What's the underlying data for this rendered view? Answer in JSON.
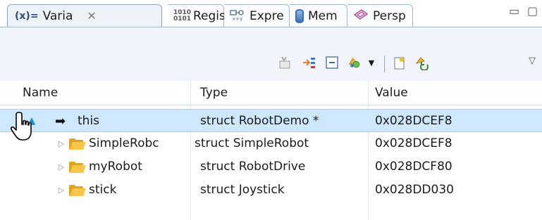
{
  "tabs": [
    {
      "label": "Varia",
      "icon": "variables-icon",
      "active": true,
      "close": "✕"
    },
    {
      "label": "Regis",
      "icon": "registers-icon"
    },
    {
      "label": "Expre",
      "icon": "expressions-icon"
    },
    {
      "label": "Mem",
      "icon": "memory-icon"
    },
    {
      "label": "Persp",
      "icon": "perspective-icon"
    }
  ],
  "icon_text": {
    "variables": "(x)=",
    "registers": "1010 0101"
  },
  "window_controls": {
    "minimize": "▭",
    "maximize": "▢"
  },
  "toolbar_icons": [
    "collapse-variables-icon",
    "show-type-names-icon",
    "collapse-all-icon",
    "add-global-variables-icon",
    "view-menu-dropdown-icon",
    "new-watch-expression-icon",
    "remove-global-variables-icon",
    "view-menu-icon"
  ],
  "table": {
    "columns": [
      "Name",
      "Type",
      "Value"
    ],
    "rows": [
      {
        "name": "this",
        "type": "struct RobotDemo *",
        "value": "0x028DCEF8",
        "expander": "expanded",
        "icon": "pointer-arrow-icon",
        "selected": true
      },
      {
        "name": "SimpleRobc",
        "type": "struct SimpleRobot",
        "value": "0x028DCEF8",
        "expander": "collapsed",
        "icon": "folder-icon"
      },
      {
        "name": "myRobot",
        "type": "struct RobotDrive",
        "value": "0x028DCF80",
        "expander": "collapsed",
        "icon": "folder-icon"
      },
      {
        "name": "stick",
        "type": "struct Joystick",
        "value": "0x028DD030",
        "expander": "collapsed",
        "icon": "folder-icon"
      }
    ]
  },
  "colors": {
    "selection_bg": "#cde8ff",
    "active_tab_bg": "#eef3fa",
    "toolbar_bg": "#f1f5fb",
    "folder": "#f7c64a"
  }
}
